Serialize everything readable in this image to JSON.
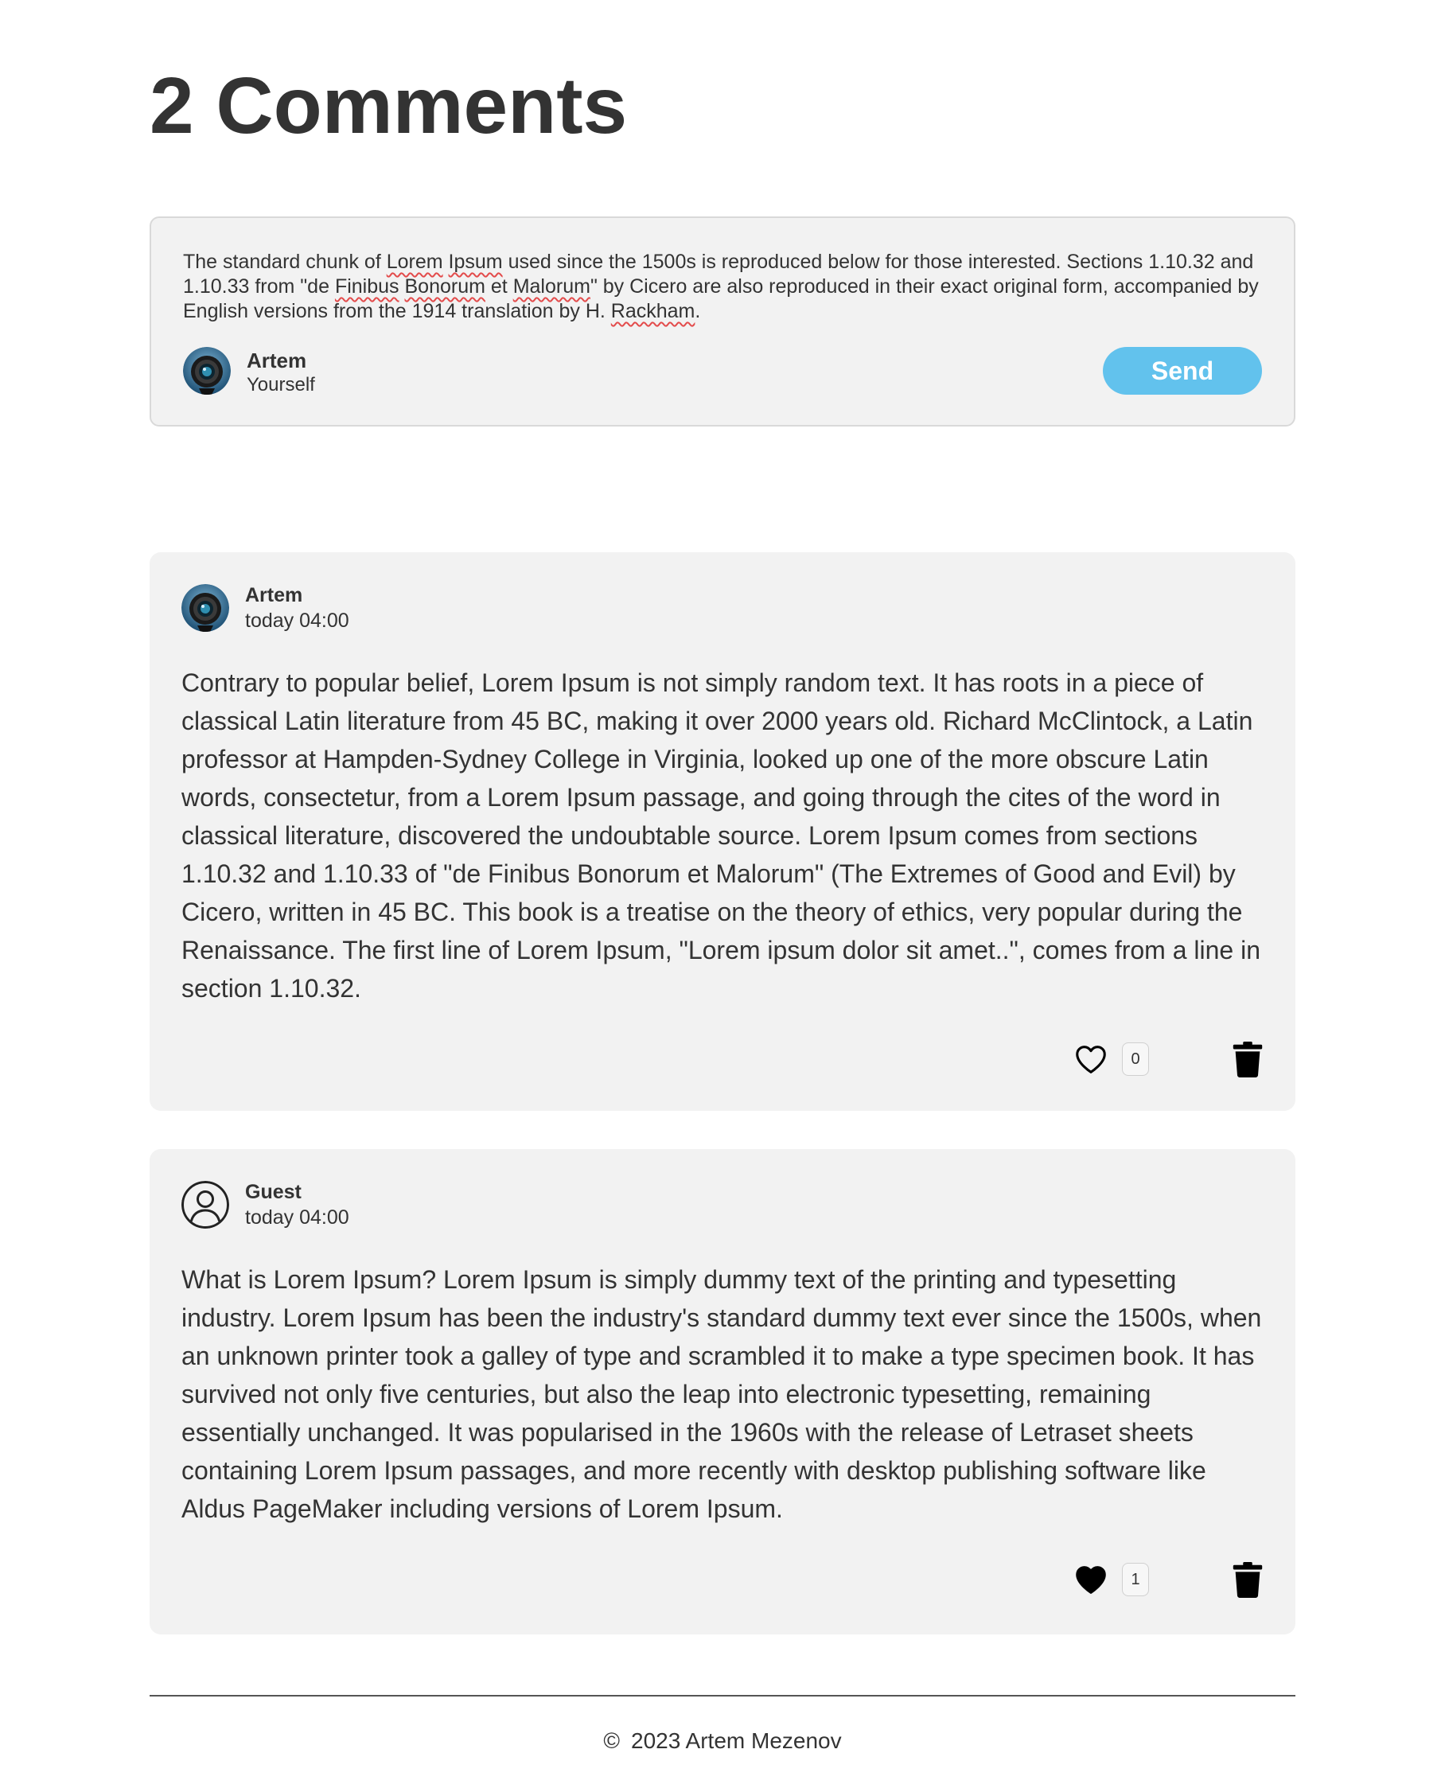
{
  "heading": "2 Comments",
  "composer": {
    "text_parts": [
      "The standard chunk of ",
      "Lorem",
      " ",
      "Ipsum",
      " used since the 1500s is reproduced below for those interested. Sections 1.10.32 and 1.10.33 from \"de ",
      "Finibus",
      " ",
      "Bonorum",
      " et ",
      "Malorum",
      "\" by Cicero are also reproduced in their exact original form, accompanied by English versions from the 1914 translation by H. ",
      "Rackham",
      "."
    ],
    "user_name": "Artem",
    "user_sub": "Yourself",
    "send_label": "Send"
  },
  "comments": [
    {
      "author": "Artem",
      "time": "today 04:00",
      "avatar": "camera-lens-avatar",
      "text": "Contrary to popular belief, Lorem Ipsum is not simply random text. It has roots in a piece of classical Latin literature from 45 BC, making it over 2000 years old. Richard McClintock, a Latin professor at Hampden-Sydney College in Virginia, looked up one of the more obscure Latin words, consectetur, from a Lorem Ipsum passage, and going through the cites of the word in classical literature, discovered the undoubtable source. Lorem Ipsum comes from sections 1.10.32 and 1.10.33 of \"de Finibus Bonorum et Malorum\" (The Extremes of Good and Evil) by Cicero, written in 45 BC. This book is a treatise on the theory of ethics, very popular during the Renaissance. The first line of Lorem Ipsum, \"Lorem ipsum dolor sit amet..\", comes from a line in section 1.10.32.",
      "likes": "0",
      "liked": false
    },
    {
      "author": "Guest",
      "time": "today 04:00",
      "avatar": "user-circle-icon",
      "text": "What is Lorem Ipsum? Lorem Ipsum is simply dummy text of the printing and typesetting industry. Lorem Ipsum has been the industry's standard dummy text ever since the 1500s, when an unknown printer took a galley of type and scrambled it to make a type specimen book. It has survived not only five centuries, but also the leap into electronic typesetting, remaining essentially unchanged. It was popularised in the 1960s with the release of Letraset sheets containing Lorem Ipsum passages, and more recently with desktop publishing software like Aldus PageMaker including versions of Lorem Ipsum.",
      "likes": "1",
      "liked": true
    }
  ],
  "footer": {
    "copyright_symbol": "©",
    "text": "2023 Artem Mezenov"
  },
  "colors": {
    "accent": "#62c2ed",
    "card_bg": "#f2f2f2",
    "text": "#333333"
  }
}
